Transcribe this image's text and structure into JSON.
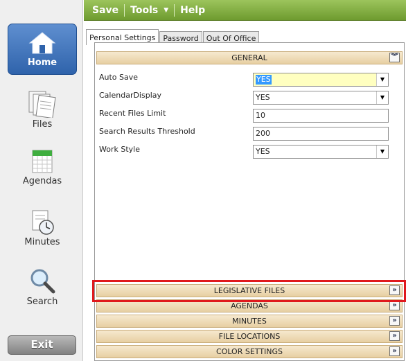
{
  "nav": {
    "items": [
      {
        "label": "Home",
        "icon": "home-icon"
      },
      {
        "label": "Files",
        "icon": "files-icon"
      },
      {
        "label": "Agendas",
        "icon": "agendas-calendar-icon"
      },
      {
        "label": "Minutes",
        "icon": "minutes-clock-icon"
      },
      {
        "label": "Search",
        "icon": "search-magnifier-icon"
      }
    ],
    "exit_label": "Exit"
  },
  "toolbar": {
    "save_label": "Save",
    "tools_label": "Tools",
    "help_label": "Help",
    "color": "#7fa93f"
  },
  "tabs": [
    {
      "label": "Personal Settings",
      "active": true
    },
    {
      "label": "Password",
      "active": false
    },
    {
      "label": "Out Of Office",
      "active": false
    }
  ],
  "general": {
    "header": "GENERAL",
    "fields": [
      {
        "label": "Auto Save",
        "value": "YES",
        "type": "select"
      },
      {
        "label": "CalendarDisplay",
        "value": "YES",
        "type": "select"
      },
      {
        "label": "Recent Files Limit",
        "value": "10",
        "type": "text"
      },
      {
        "label": "Search Results Threshold",
        "value": "200",
        "type": "text"
      },
      {
        "label": "Work Style",
        "value": "YES",
        "type": "select"
      }
    ]
  },
  "sections": [
    {
      "label": "LEGISLATIVE FILES"
    },
    {
      "label": "AGENDAS"
    },
    {
      "label": "MINUTES"
    },
    {
      "label": "FILE LOCATIONS"
    },
    {
      "label": "COLOR SETTINGS"
    }
  ],
  "colors": {
    "header_bg": "#ecd7af",
    "highlight_outline": "#e0191d",
    "nav_active": "#3f72bb"
  }
}
